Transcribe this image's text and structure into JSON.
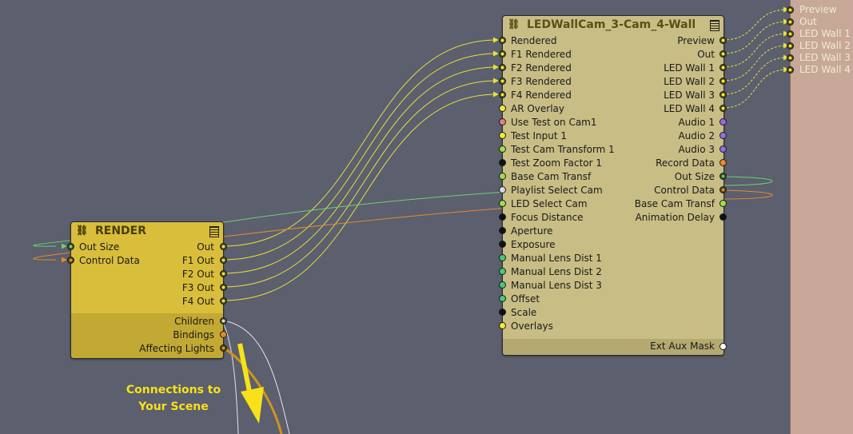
{
  "render_node": {
    "title": "RENDER",
    "inputs": [
      "Out Size",
      "Control Data"
    ],
    "outputs": [
      "Out",
      "F1 Out",
      "F2 Out",
      "F3 Out",
      "F4 Out"
    ],
    "aux_outputs": [
      "Children",
      "Bindings",
      "Affecting Lights"
    ]
  },
  "led_node": {
    "title": "LEDWallCam_3-Cam_4-Wall",
    "inputs": [
      "Rendered",
      "F1 Rendered",
      "F2 Rendered",
      "F3 Rendered",
      "F4 Rendered",
      "AR Overlay",
      "Use Test on Cam1",
      "Test Input 1",
      "Test Cam Transform 1",
      "Test Zoom Factor 1",
      "Base Cam Transf",
      "Playlist Select Cam",
      "LED Select Cam",
      "Focus Distance",
      "Aperture",
      "Exposure",
      "Manual Lens Dist 1",
      "Manual Lens Dist 2",
      "Manual Lens Dist 3",
      "Offset",
      "Scale",
      "Overlays"
    ],
    "outputs": [
      "Preview",
      "Out",
      "LED Wall 1",
      "LED Wall 2",
      "LED Wall 3",
      "LED Wall 4",
      "Audio 1",
      "Audio 2",
      "Audio 3",
      "Record Data",
      "Out Size",
      "Control Data",
      "Base Cam Transf",
      "Animation Delay"
    ],
    "aux_output": "Ext Aux Mask"
  },
  "external_outputs": [
    "Preview",
    "Out",
    "LED Wall 1",
    "LED Wall 2",
    "LED Wall 3",
    "LED Wall 4"
  ],
  "caption": {
    "line1": "Connections to",
    "line2": "Your Scene"
  },
  "colors": {
    "background": "#5b5f6e",
    "render_node": "#d9be3b",
    "led_node": "#c8bd85",
    "side_panel": "#c8a898",
    "wire_yellow": "#e8df3c",
    "wire_green": "#6fcf73",
    "wire_orange": "#e68a2e",
    "wire_white": "#e6e6e6",
    "caption": "#f7e21a"
  }
}
